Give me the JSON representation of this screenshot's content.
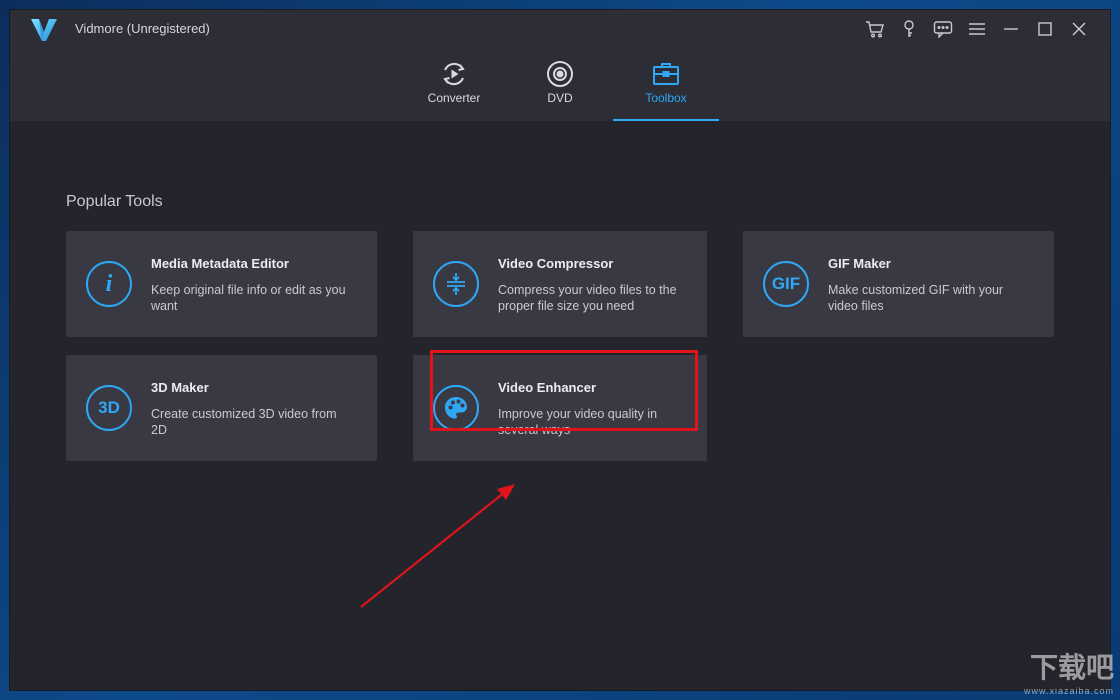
{
  "app": {
    "title": "Vidmore (Unregistered)"
  },
  "window_controls": [
    {
      "name": "cart-icon"
    },
    {
      "name": "key-icon"
    },
    {
      "name": "feedback-icon"
    },
    {
      "name": "menu-icon"
    },
    {
      "name": "minimize-icon"
    },
    {
      "name": "maximize-icon"
    },
    {
      "name": "close-icon"
    }
  ],
  "tabs": [
    {
      "label": "Converter",
      "icon": "converter-icon",
      "active": false
    },
    {
      "label": "DVD",
      "icon": "dvd-icon",
      "active": false
    },
    {
      "label": "Toolbox",
      "icon": "toolbox-icon",
      "active": true
    }
  ],
  "section": {
    "title": "Popular Tools"
  },
  "tools": [
    {
      "title": "Media Metadata Editor",
      "desc": "Keep original file info or edit as you want",
      "icon": "info-icon",
      "icon_text": "i"
    },
    {
      "title": "Video Compressor",
      "desc": "Compress your video files to the proper file size you need",
      "icon": "compress-icon",
      "icon_text": ""
    },
    {
      "title": "GIF Maker",
      "desc": "Make customized GIF with your video files",
      "icon": "gif-icon",
      "icon_text": "GIF"
    },
    {
      "title": "3D Maker",
      "desc": "Create customized 3D video from 2D",
      "icon": "3d-icon",
      "icon_text": "3D"
    },
    {
      "title": "Video Enhancer",
      "desc": "Improve your video quality in several ways",
      "icon": "palette-icon",
      "icon_text": ""
    }
  ],
  "annotation": {
    "highlight_color": "#e0141b"
  },
  "watermark": {
    "text": "下载吧",
    "url": "www.xiazaiba.com"
  },
  "colors": {
    "accent": "#2ea8f5",
    "background": "#24242c",
    "card": "#393944"
  }
}
